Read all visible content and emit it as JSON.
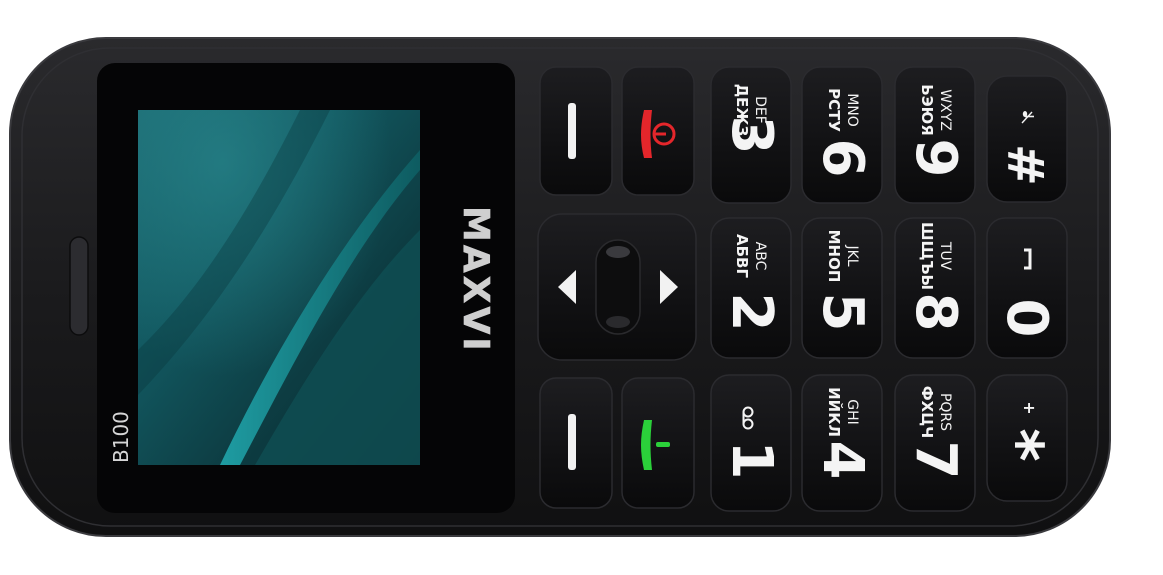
{
  "brand": {
    "logo": "MAXVI",
    "model": "B100"
  },
  "colors": {
    "body": "#1e1e20",
    "key": "#141416",
    "key_text": "#f4f4f4",
    "end_call": "#e4262b",
    "call": "#2bd03a",
    "screen_dark": "#0b2c30",
    "screen_mid": "#15777d",
    "screen_light": "#2aa8ad"
  },
  "keys": {
    "k1": {
      "digit": "1",
      "cyr": "",
      "lat": "",
      "extra": "voicemail-icon"
    },
    "k2": {
      "digit": "2",
      "cyr": "АБВГ",
      "lat": "ABC"
    },
    "k3": {
      "digit": "3",
      "cyr": "ДЕЖЗ",
      "lat": "DEF"
    },
    "k4": {
      "digit": "4",
      "cyr": "ИЙКЛ",
      "lat": "GHI"
    },
    "k5": {
      "digit": "5",
      "cyr": "МНОП",
      "lat": "JKL"
    },
    "k6": {
      "digit": "6",
      "cyr": "РСТУ",
      "lat": "MNO"
    },
    "k7": {
      "digit": "7",
      "cyr": "ФХЦЧ",
      "lat": "PQRS"
    },
    "k8": {
      "digit": "8",
      "cyr": "ШЩЪЫ",
      "lat": "TUV"
    },
    "k9": {
      "digit": "9",
      "cyr": "ЬЭЮЯ",
      "lat": "WXYZ"
    },
    "k0": {
      "digit": "0",
      "extra": "space-icon"
    },
    "star": {
      "symbol": "*",
      "sub": "+"
    },
    "hash": {
      "symbol": "#",
      "extra": "silent-mode-icon"
    }
  },
  "icons": {
    "left_soft": "soft-key-dash-icon",
    "right_soft": "soft-key-dash-icon",
    "end": "power-end-call-icon",
    "call": "call-icon",
    "nav_left": "arrow-left-icon",
    "nav_right": "arrow-right-icon"
  }
}
